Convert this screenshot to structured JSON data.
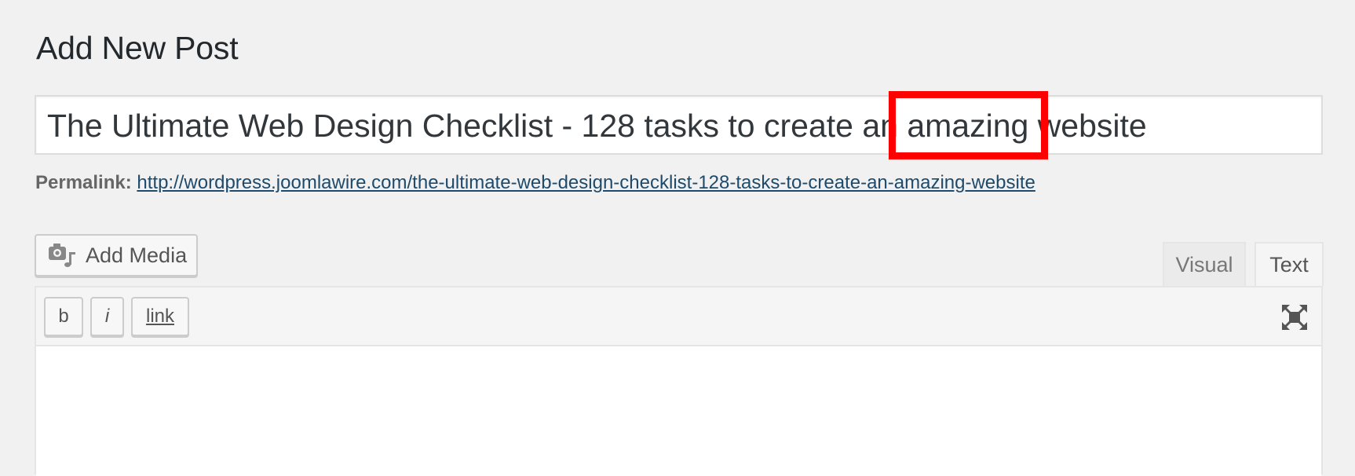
{
  "page": {
    "title": "Add New Post"
  },
  "post": {
    "title_value": "The Ultimate Web Design Checklist - 128 tasks to create an amazing website",
    "permalink_label": "Permalink:",
    "permalink_url": "http://wordpress.joomlawire.com/the-ultimate-web-design-checklist-128-tasks-to-create-an-amazing-website"
  },
  "media": {
    "add_media_label": "Add Media",
    "icon": "camera-music-icon"
  },
  "editor": {
    "tabs": [
      {
        "label": "Visual"
      },
      {
        "label": "Text"
      }
    ],
    "active_tab": "Text",
    "quicktags": [
      {
        "label": "b"
      },
      {
        "label": "i"
      },
      {
        "label": "link"
      }
    ],
    "fullscreen_icon": "fullscreen-icon",
    "content": ""
  },
  "colors": {
    "highlight": "#ff0000",
    "link": "#1e4a6b",
    "background": "#f1f1f1"
  }
}
